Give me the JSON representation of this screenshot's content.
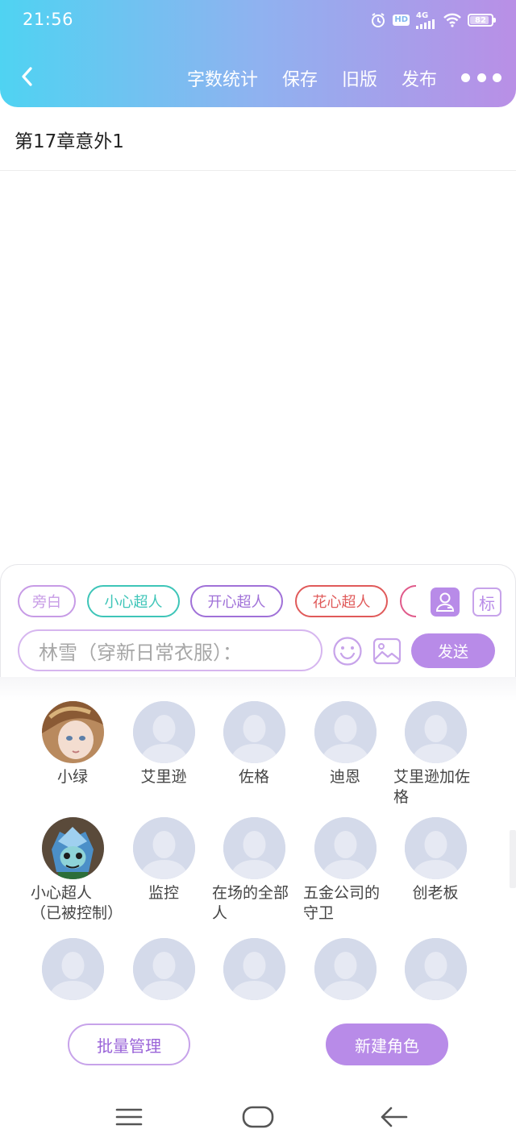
{
  "status_bar": {
    "time": "21:56",
    "hd_label": "HD",
    "network": "4G",
    "battery": "82",
    "battery_level": 0.82
  },
  "header": {
    "back_icon": "chevron-left-icon",
    "actions": [
      "字数统计",
      "保存",
      "旧版",
      "发布"
    ],
    "more_icon": "more-dots-icon",
    "gradient": [
      "#4fd3f2",
      "#b98fe6"
    ]
  },
  "chapter": {
    "title": "第17章意外1"
  },
  "editor": {
    "chips": [
      {
        "label": "旁白",
        "color": "#c79be6"
      },
      {
        "label": "小心超人",
        "color": "#3ec5b8"
      },
      {
        "label": "开心超人",
        "color": "#a071d8"
      },
      {
        "label": "花心超人",
        "color": "#e05a5a"
      },
      {
        "label": "",
        "color": "#e05a8a"
      }
    ],
    "role_icon": "user-card-icon",
    "mark_label": "标",
    "input_placeholder": "林雪（穿新日常衣服）：",
    "emoji_icon": "smile-icon",
    "image_icon": "image-icon",
    "send_label": "发送"
  },
  "characters": [
    {
      "name": "小绿",
      "avatar": "custom-green"
    },
    {
      "name": "艾里逊",
      "avatar": "default"
    },
    {
      "name": "佐格",
      "avatar": "default"
    },
    {
      "name": "迪恩",
      "avatar": "default"
    },
    {
      "name": "艾里逊加佐格",
      "avatar": "default"
    },
    {
      "name": "小心超人（已被控制）",
      "avatar": "custom-robot"
    },
    {
      "name": "监控",
      "avatar": "default"
    },
    {
      "name": "在场的全部人",
      "avatar": "default"
    },
    {
      "name": "五金公司的守卫",
      "avatar": "default"
    },
    {
      "name": "创老板",
      "avatar": "default"
    },
    {
      "name": "",
      "avatar": "default"
    },
    {
      "name": "",
      "avatar": "default"
    },
    {
      "name": "",
      "avatar": "default"
    },
    {
      "name": "",
      "avatar": "default"
    },
    {
      "name": "",
      "avatar": "default"
    }
  ],
  "actions": {
    "batch_manage": "批量管理",
    "new_role": "新建角色"
  },
  "system_nav": {
    "menu_icon": "menu-icon",
    "home_icon": "home-icon",
    "back_icon": "back-arrow-icon"
  },
  "colors": {
    "accent": "#b88be8",
    "avatar_placeholder": "#d4daea"
  }
}
